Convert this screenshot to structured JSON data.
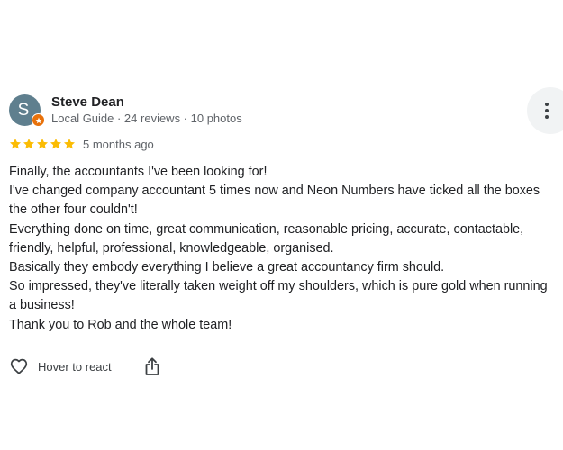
{
  "reviewer": {
    "initial": "S",
    "name": "Steve Dean",
    "meta": "Local Guide · 24 reviews · 10 photos",
    "avatar_color": "#5f7f8e",
    "badge_color": "#e8710a",
    "badge_icon": "star-icon"
  },
  "rating": {
    "stars": 5,
    "max": 5,
    "star_color": "#fbbc04",
    "time_ago": "5 months ago"
  },
  "review_lines": [
    "Finally, the accountants I've been looking for!",
    "I've changed company accountant 5 times now and Neon Numbers have ticked all the boxes the other four couldn't!",
    "Everything done on time, great communication, reasonable pricing, accurate, contactable, friendly, helpful, professional, knowledgeable, organised.",
    "Basically they embody everything I believe a great accountancy firm should.",
    "So impressed, they've literally taken weight off my shoulders, which is pure gold when running a business!",
    "Thank you to Rob and the whole team!"
  ],
  "actions": {
    "react_label": "Hover to react",
    "react_icon": "heart-outline-icon",
    "share_icon": "share-icon",
    "more_icon": "more-vertical-icon"
  }
}
